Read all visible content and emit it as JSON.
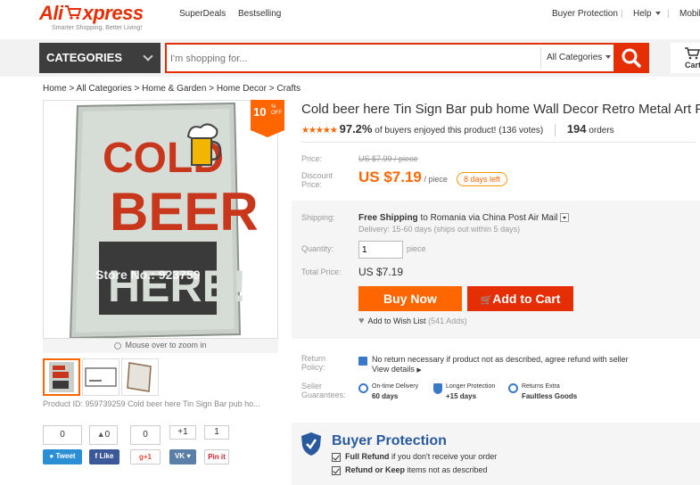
{
  "header": {
    "logo_ali": "Ali",
    "logo_express": "xpress",
    "tagline": "Smarter Shopping, Better Living!",
    "nav_superdeals": "SuperDeals",
    "nav_bestselling": "Bestselling",
    "buyer_protection": "Buyer Protection",
    "help": "Help",
    "mobile": "Mobile"
  },
  "search": {
    "categories_label": "CATEGORIES",
    "placeholder": "I'm shopping for...",
    "scope": "All Categories",
    "cart_label": "Cart"
  },
  "breadcrumb": "Home > All Categories > Home & Garden > Home Decor > Crafts",
  "gallery": {
    "discount_num": "10",
    "discount_pct": "%",
    "discount_off": "OFF",
    "sign_line1": "COLD",
    "sign_line2": "BEER",
    "sign_line3": "HERE!",
    "watermark": "Store No.: 923759",
    "zoom_hint": "Mouse over to zoom in",
    "product_id": "Product ID: 959739259 Cold beer here Tin Sign Bar pub ho..."
  },
  "social": {
    "tweet_count": "0",
    "tweet_label": "Tweet",
    "like_count": "0",
    "like_label": "Like",
    "gplus_count": "0",
    "gplus_label": "+1",
    "vk_count": "+1",
    "pin_count": "1",
    "pin_label": "Pin it"
  },
  "product": {
    "title": "Cold beer here Tin Sign Bar pub home Wall Decor Retro Metal Art Post",
    "stars": "★★★★★",
    "rating_pct": "97.2%",
    "rating_text": "of buyers enjoyed this product! (136 votes)",
    "orders_count": "194",
    "orders_label": "orders",
    "price_label": "Price:",
    "price_old": "US $7.99 / piece",
    "discount_label_1": "Discount",
    "discount_label_2": "Price:",
    "price_new": "US $7.19",
    "price_per": " / piece",
    "days_left": "8 days left",
    "shipping_label": "Shipping:",
    "shipping_bold": "Free Shipping",
    "shipping_rest": " to  Romania via China Post Air Mail",
    "delivery": "Delivery: 15-60 days (ships out within 5 days)",
    "quantity_label": "Quantity:",
    "quantity_value": "1",
    "quantity_unit": "piece",
    "total_label": "Total Price:",
    "total_value": "US $7.19",
    "buy_now": "Buy Now",
    "add_to_cart": "Add to Cart",
    "wishlist": "Add to Wish List",
    "wishlist_count": "(541 Adds)",
    "return_label_1": "Return",
    "return_label_2": "Policy:",
    "return_text": "No return necessary if product not as described, agree refund with seller",
    "view_details": "View details",
    "guarantee_label_1": "Seller",
    "guarantee_label_2": "Guarantees:",
    "g1_title": "On-time Delivery",
    "g1_sub": "60 days",
    "g2_title": "Longer Protection",
    "g2_sub": "+15 days",
    "g3_title": "Returns Extra",
    "g3_sub": "Faultless Goods"
  },
  "buyer_protection": {
    "title": "Buyer Protection",
    "line1_bold": "Full Refund",
    "line1_rest": " if you don't receive your order",
    "line2_bold": "Refund or Keep",
    "line2_rest": " items not as described"
  },
  "colors": {
    "brand_red": "#e62e04",
    "accent_orange": "#ff6600",
    "protection_blue": "#2a5a9e"
  }
}
